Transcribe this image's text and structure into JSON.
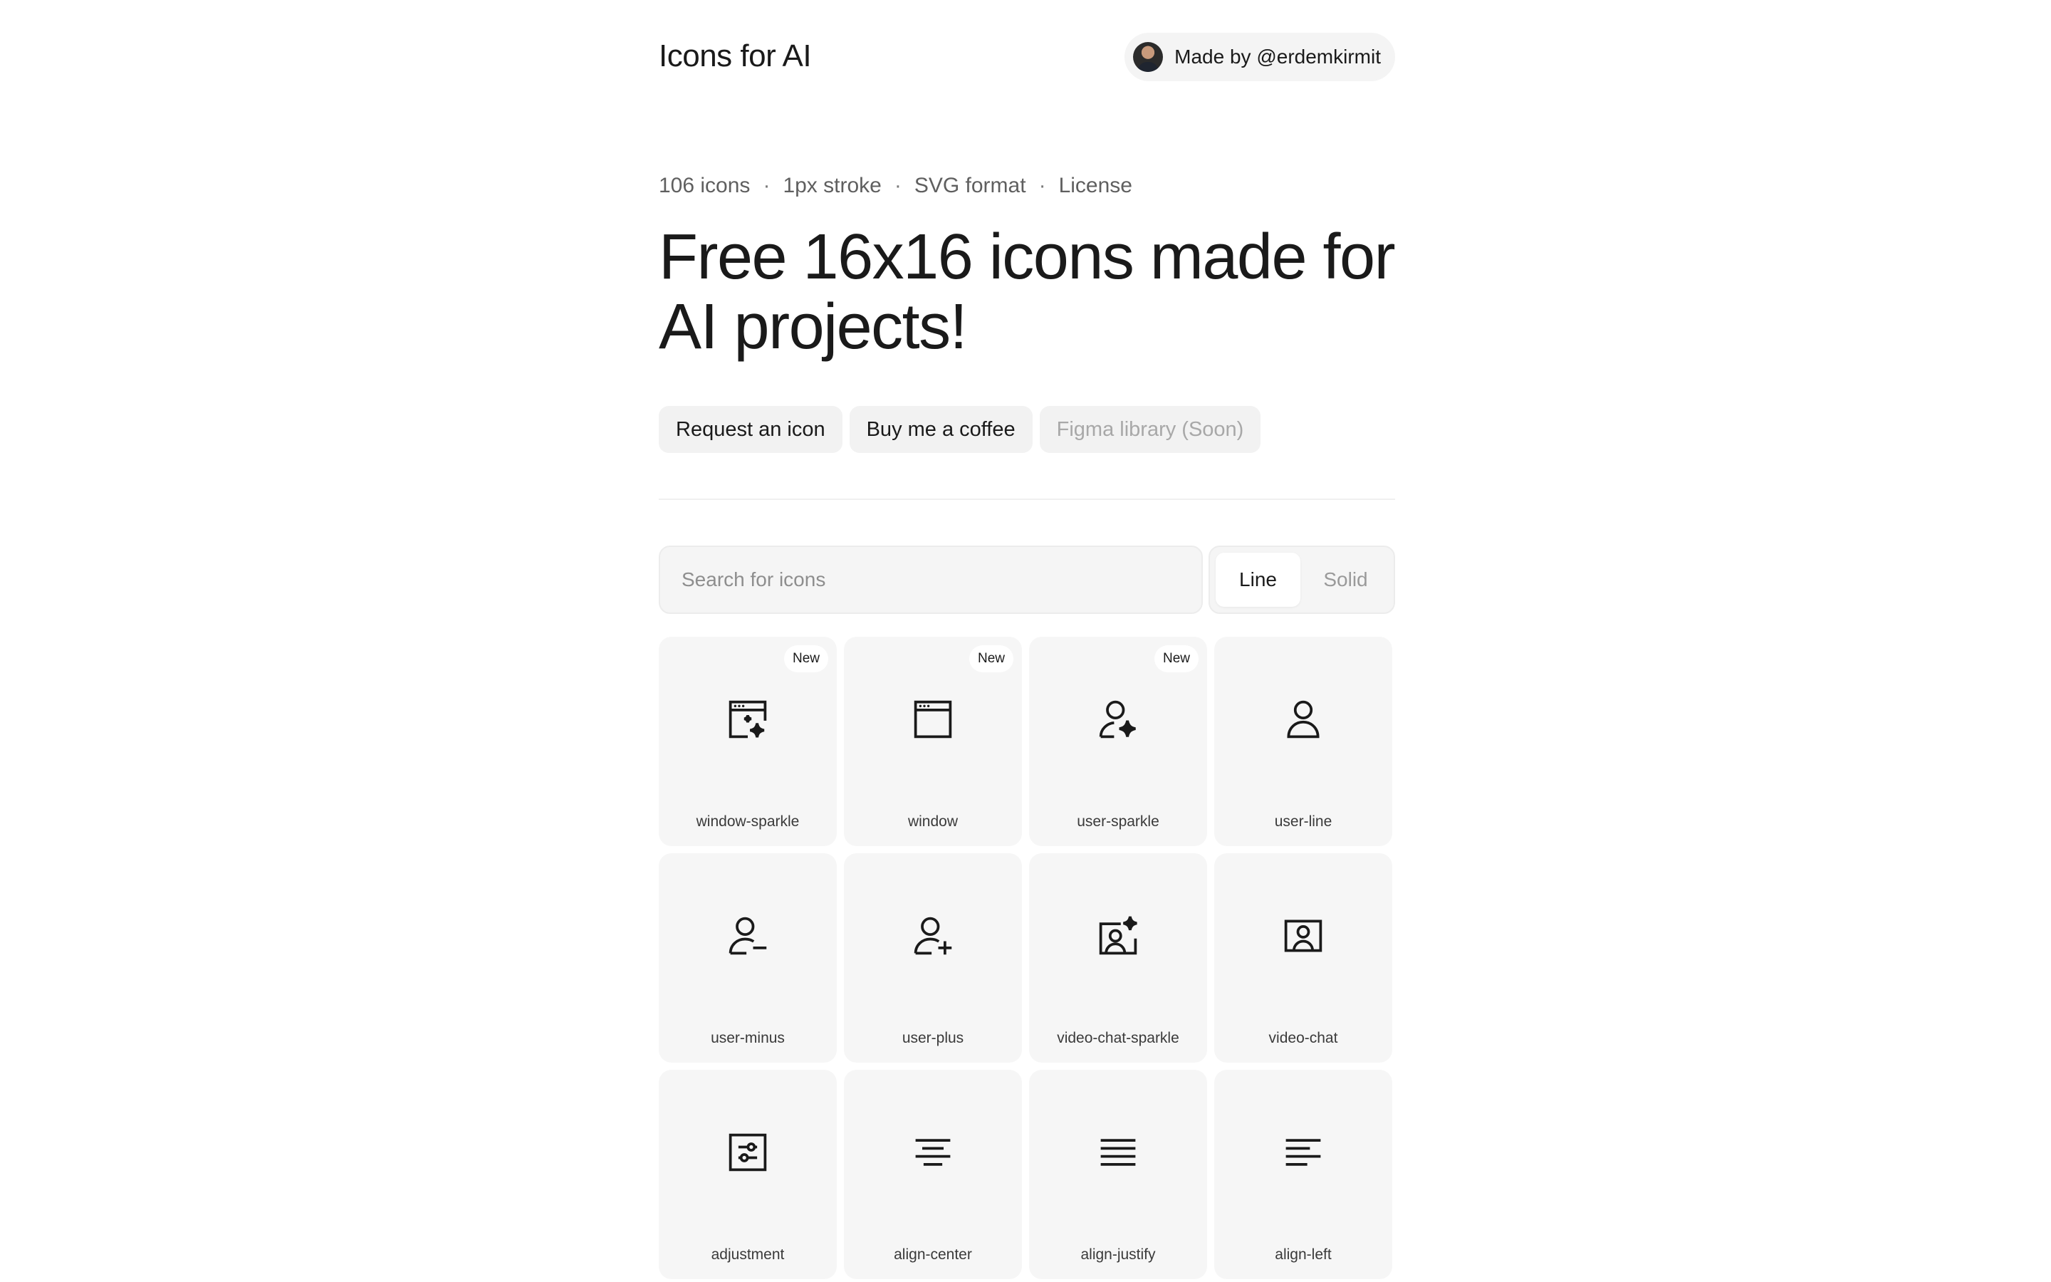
{
  "header": {
    "title": "Icons for AI",
    "made_by": "Made by @erdemkirmit"
  },
  "meta": {
    "count": "106 icons",
    "stroke": "1px stroke",
    "format": "SVG format",
    "license": "License",
    "separator": "·"
  },
  "hero": {
    "headline": "Free 16x16 icons made for AI projects!"
  },
  "actions": {
    "request": "Request an icon",
    "coffee": "Buy me a coffee",
    "figma": "Figma library (Soon)"
  },
  "search": {
    "placeholder": "Search for icons"
  },
  "style_toggle": {
    "line": "Line",
    "solid": "Solid",
    "selected": "Line"
  },
  "icons": [
    {
      "name": "window-sparkle",
      "badge": "New"
    },
    {
      "name": "window",
      "badge": "New"
    },
    {
      "name": "user-sparkle",
      "badge": "New"
    },
    {
      "name": "user-line"
    },
    {
      "name": "user-minus"
    },
    {
      "name": "user-plus"
    },
    {
      "name": "video-chat-sparkle"
    },
    {
      "name": "video-chat"
    },
    {
      "name": "adjustment"
    },
    {
      "name": "align-center"
    },
    {
      "name": "align-justify"
    },
    {
      "name": "align-left"
    }
  ]
}
